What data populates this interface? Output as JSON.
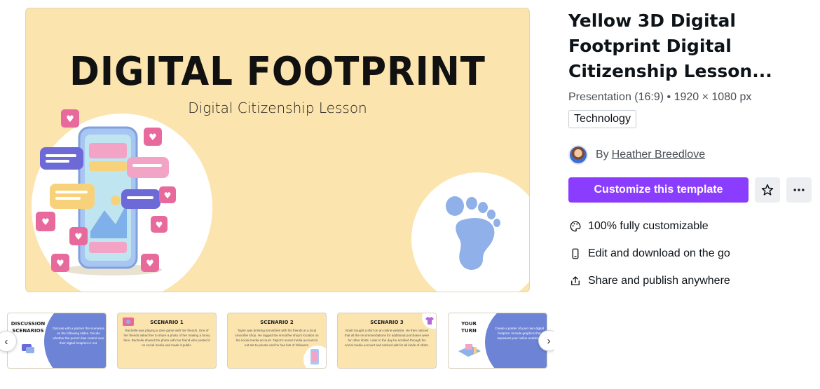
{
  "preview": {
    "slide_title": "DIGITAL FOOTPRINT",
    "slide_subtitle": "Digital Citizenship Lesson",
    "colors": {
      "background": "#fbe4ae",
      "accent_blue": "#8fb0e8",
      "accent_pink": "#e86a9c",
      "accent_purple": "#6d6ad8"
    }
  },
  "template": {
    "title": "Yellow 3D Digital Footprint Digital Citizenship Lesson...",
    "meta": "Presentation (16:9) • 1920 × 1080 px",
    "tag": "Technology",
    "author_prefix": "By",
    "author_name": "Heather Breedlove",
    "customize_label": "Customize this template",
    "star_icon": "star-icon",
    "more_icon": "more-icon",
    "primary_color": "#8b3dff"
  },
  "features": [
    {
      "icon": "palette-icon",
      "label": "100% fully customizable"
    },
    {
      "icon": "mobile-icon",
      "label": "Edit and download on the go"
    },
    {
      "icon": "share-icon",
      "label": "Share and publish anywhere"
    }
  ],
  "thumbnails": [
    {
      "heading": "DISCUSSION SCENARIOS",
      "text": "Discuss with a partner the scenarios on the following slides. Decide whether the person has control over their digital footprint or not."
    },
    {
      "heading": "SCENARIO 1",
      "text": "Rachelle was playing a dare game with her friends. One of her friends asked her to share a photo of her making a funny face. Rachelle shared the photo with her friend who posted it on social media and made it public."
    },
    {
      "heading": "SCENARIO 2",
      "text": "Taylor was drinking smoothies with his friends at a local smoothie shop. He tagged the smoothie shop's location on his social media account. Taylor's social media account is not set to private and he has lots of followers."
    },
    {
      "heading": "SCENARIO 3",
      "text": "Noah bought a shirt on an online website. He then noticed that all the recommendations for additional purchases were for other shirts. Later in the day he scrolled through his social media account and noticed ads for all kinds of shirts."
    },
    {
      "heading": "YOUR TURN",
      "text": "Create a poster of your own digital footprint. Include graphics that represent your online activities."
    }
  ],
  "nav": {
    "prev_icon": "chevron-left-icon",
    "next_icon": "chevron-right-icon"
  }
}
